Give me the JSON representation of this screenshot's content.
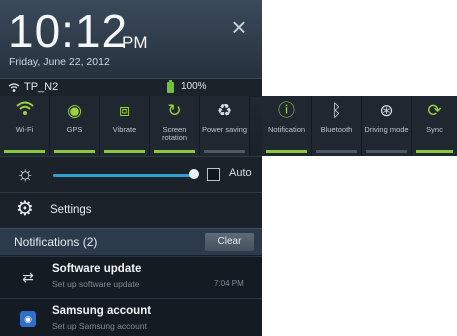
{
  "header": {
    "time": "10:12",
    "ampm": "PM",
    "date": "Friday, June 22, 2012",
    "close_icon": "close-icon"
  },
  "status": {
    "network": "TP_N2",
    "battery": "100%",
    "battery_color": "#6ac53a"
  },
  "toggles": [
    {
      "label": "Wi-Fi",
      "icon": "wifi-icon",
      "on": true
    },
    {
      "label": "GPS",
      "icon": "gps-icon",
      "on": true
    },
    {
      "label": "Vibrate",
      "icon": "vibrate-icon",
      "on": true
    },
    {
      "label": "Screen rotation",
      "icon": "rotation-icon",
      "on": true
    },
    {
      "label": "Power saving",
      "icon": "recycle-icon",
      "on": true
    },
    {
      "label": "Notification",
      "icon": "info-icon",
      "on": true
    },
    {
      "label": "Bluetooth",
      "icon": "bluetooth-icon",
      "on": false
    },
    {
      "label": "Driving mode",
      "icon": "steering-wheel-icon",
      "on": false
    },
    {
      "label": "Sync",
      "icon": "sync-icon",
      "on": true
    }
  ],
  "brightness": {
    "auto_label": "Auto",
    "level": 0.97,
    "auto_checked": false
  },
  "settings": {
    "label": "Settings"
  },
  "notifications": {
    "title": "Notifications (2)",
    "clear_label": "Clear",
    "items": [
      {
        "title": "Software update",
        "subtitle": "Set up software update",
        "time": "7:04 PM",
        "icon": "sync-arrows-icon"
      },
      {
        "title": "Samsung account",
        "subtitle": "Set up Samsung account",
        "time": "",
        "icon": "samsung-account-icon"
      }
    ]
  },
  "colors": {
    "accent_green": "#8dc63f",
    "slider_blue": "#2f9fd0"
  }
}
